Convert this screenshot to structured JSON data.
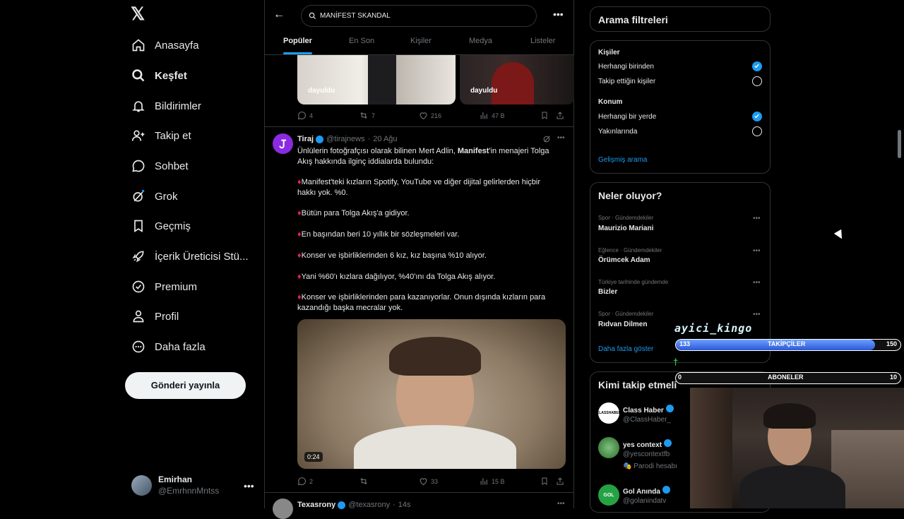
{
  "sidebar": {
    "logo": "𝕏",
    "items": [
      {
        "label": "Anasayfa",
        "icon": "home-icon"
      },
      {
        "label": "Keşfet",
        "icon": "search-icon"
      },
      {
        "label": "Bildirimler",
        "icon": "bell-icon"
      },
      {
        "label": "Takip et",
        "icon": "person-add-icon"
      },
      {
        "label": "Sohbet",
        "icon": "chat-icon"
      },
      {
        "label": "Grok",
        "icon": "grok-icon"
      },
      {
        "label": "Geçmiş",
        "icon": "bookmark-icon"
      },
      {
        "label": "İçerik Üreticisi Stü...",
        "icon": "rocket-icon"
      },
      {
        "label": "Premium",
        "icon": "premium-icon"
      },
      {
        "label": "Profil",
        "icon": "person-icon"
      },
      {
        "label": "Daha fazla",
        "icon": "more-circle-icon"
      }
    ],
    "post_button": "Gönderi yayınla",
    "user": {
      "name": "Emirhan",
      "handle": "@EmrhnnMntss"
    }
  },
  "feed": {
    "search_value": "MANİFEST SKANDAL",
    "tabs": [
      "Popüler",
      "En Son",
      "Kişiler",
      "Medya",
      "Listeler"
    ],
    "watermark": "dayuldu",
    "post1_actions": {
      "replies": "4",
      "reposts": "7",
      "likes": "216",
      "views": "47 B"
    },
    "post2": {
      "name": "Tiraj",
      "handle": "@tirajnews",
      "date": "20 Ağu",
      "intro_a": "Ünlülerin fotoğrafçısı olarak bilinen Mert Adlin, ",
      "intro_bold": "Manifest",
      "intro_b": "'in menajeri Tolga",
      "intro_2": "Akış hakkında ilginç iddialarda bulundu:",
      "bullets": [
        [
          "Manifest'teki kızların Spotify, YouTube ve diğer dijital gelirlerden hiçbir",
          "hakkı yok. %0."
        ],
        [
          "Bütün para Tolga Akış'a gidiyor."
        ],
        [
          "En başından beri 10 yıllık bir sözleşmeleri var."
        ],
        [
          "Konser ve işbirliklerinden 6 kız, kız başına %10 alıyor."
        ],
        [
          "Yani %60'ı kızlara dağılıyor, %40'ını da Tolga Akış alıyor."
        ],
        [
          "Konser ve işbirliklerinden para kazanıyorlar. Onun dışında kızların para",
          "kazandığı başka mecralar yok."
        ]
      ],
      "video_time": "0:24",
      "actions": {
        "replies": "2",
        "reposts": "",
        "likes": "33",
        "views": "15 B"
      }
    },
    "post3": {
      "name": "Texasrony",
      "handle": "@texasrony",
      "date": "14s"
    }
  },
  "right": {
    "filters_title": "Arama filtreleri",
    "people_heading": "Kişiler",
    "people_options": [
      "Herhangi birinden",
      "Takip ettiğin kişiler"
    ],
    "location_heading": "Konum",
    "location_options": [
      "Herhangi bir yerde",
      "Yakınlarında"
    ],
    "advanced": "Gelişmiş arama",
    "trends_title": "Neler oluyor?",
    "trends": [
      {
        "meta": "Spor · Gündemdekiler",
        "name": "Maurizio Mariani"
      },
      {
        "meta": "Eğlence · Gündemdekiler",
        "name": "Örümcek Adam"
      },
      {
        "meta": "Türkiye tarihinde gündemde",
        "name": "Bizler"
      },
      {
        "meta": "Spor · Gündemdekiler",
        "name": "Rıdvan Dilmen"
      }
    ],
    "show_more": "Daha fazla göster",
    "who_title": "Kimi takip etmeli",
    "who": [
      {
        "name": "Class Haber",
        "handle": "@ClassHaber_",
        "sub": "",
        "logo": "CLASSHABER"
      },
      {
        "name": "yes context",
        "handle": "@yescontextfb",
        "sub": "Parodi hesabı",
        "logo": ""
      },
      {
        "name": "Gol Anında",
        "handle": "@golanindatv",
        "sub": "",
        "logo": "GOL"
      }
    ]
  },
  "overlay": {
    "streamer": "ayici_kingo",
    "followers": {
      "label": "TAKİPÇİLER",
      "current": "133",
      "goal": "150",
      "progress": 0.887
    },
    "subs": {
      "label": "ABONELER",
      "current": "0",
      "goal": "10",
      "progress": 0
    }
  },
  "colors": {
    "accent": "#1d9bf0",
    "bg": "#000000",
    "border": "#2f3336",
    "muted": "#71767b"
  }
}
